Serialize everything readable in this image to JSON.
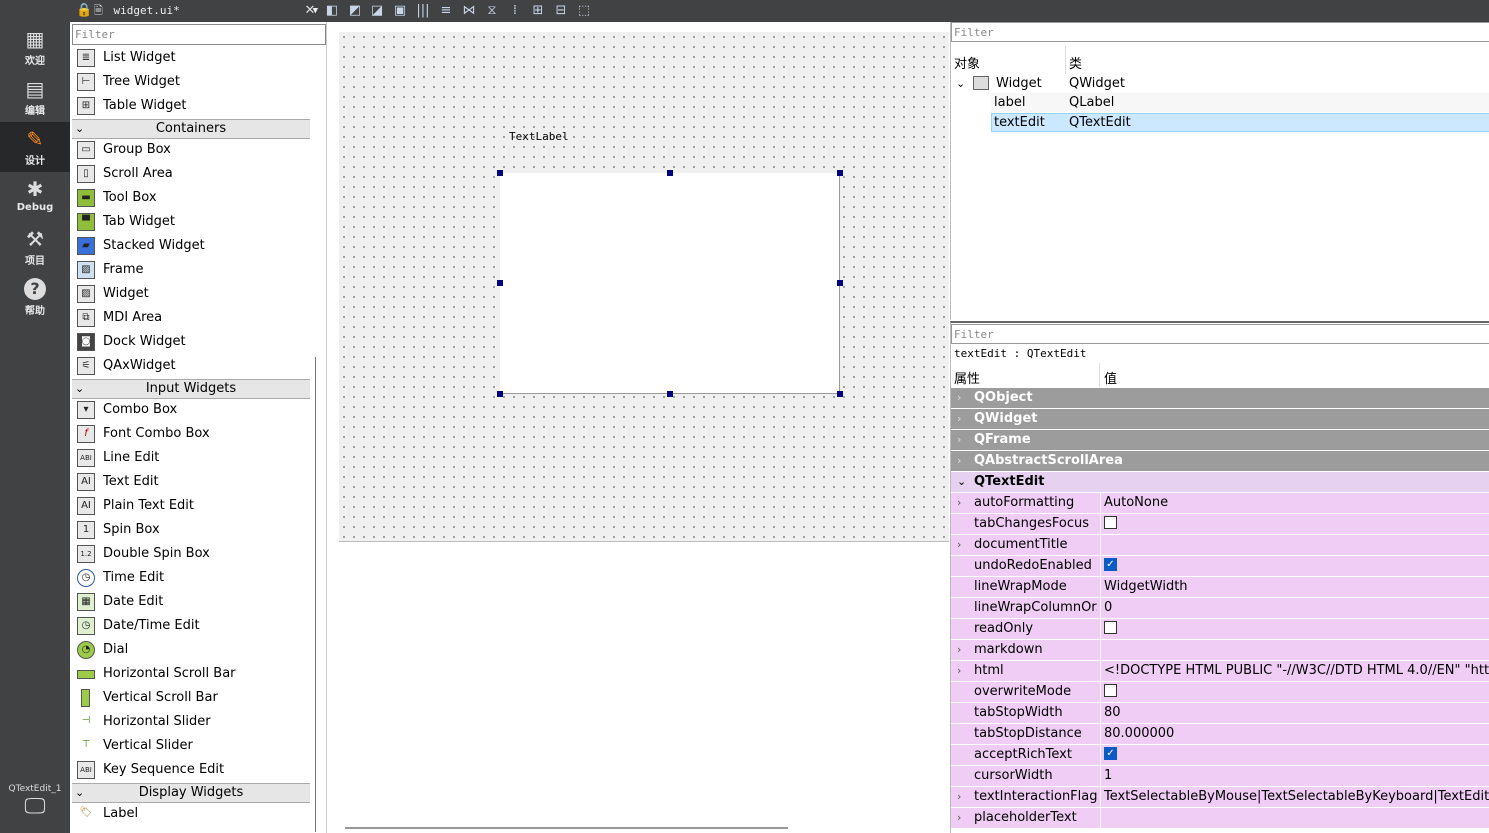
{
  "modes": [
    {
      "label": "欢迎",
      "icon": "grid-icon"
    },
    {
      "label": "编辑",
      "icon": "document-icon"
    },
    {
      "label": "设计",
      "icon": "pencil-icon"
    },
    {
      "label": "Debug",
      "icon": "bug-icon"
    },
    {
      "label": "项目",
      "icon": "wrench-icon"
    },
    {
      "label": "帮助",
      "icon": "help-icon"
    }
  ],
  "kit_label": "QTextEdit_1",
  "file_tab": "widget.ui*",
  "widget_box": {
    "filter_placeholder": "Filter",
    "items_top": [
      "List Widget",
      "Tree Widget",
      "Table Widget"
    ],
    "cat_containers": "Containers",
    "containers": [
      "Group Box",
      "Scroll Area",
      "Tool Box",
      "Tab Widget",
      "Stacked Widget",
      "Frame",
      "Widget",
      "MDI Area",
      "Dock Widget",
      "QAxWidget"
    ],
    "cat_input": "Input Widgets",
    "inputs": [
      "Combo Box",
      "Font Combo Box",
      "Line Edit",
      "Text Edit",
      "Plain Text Edit",
      "Spin Box",
      "Double Spin Box",
      "Time Edit",
      "Date Edit",
      "Date/Time Edit",
      "Dial",
      "Horizontal Scroll Bar",
      "Vertical Scroll Bar",
      "Horizontal Slider",
      "Vertical Slider",
      "Key Sequence Edit"
    ],
    "cat_display": "Display Widgets",
    "displays": [
      "Label"
    ]
  },
  "form": {
    "text_label": "TextLabel"
  },
  "object_inspector": {
    "filter_placeholder": "Filter",
    "col_object": "对象",
    "col_class": "类",
    "rows": [
      {
        "object": "Widget",
        "class": "QWidget"
      },
      {
        "object": "label",
        "class": "QLabel"
      },
      {
        "object": "textEdit",
        "class": "QTextEdit"
      }
    ]
  },
  "property_editor": {
    "filter_placeholder": "Filter",
    "context": "textEdit : QTextEdit",
    "col_property": "属性",
    "col_value": "值",
    "groups": [
      "QObject",
      "QWidget",
      "QFrame",
      "QAbstractScrollArea",
      "QTextEdit"
    ],
    "props": [
      {
        "name": "autoFormatting",
        "value": "AutoNone"
      },
      {
        "name": "tabChangesFocus",
        "value": ""
      },
      {
        "name": "documentTitle",
        "value": ""
      },
      {
        "name": "undoRedoEnabled",
        "value": ""
      },
      {
        "name": "lineWrapMode",
        "value": "WidgetWidth"
      },
      {
        "name": "lineWrapColumnOr...",
        "value": "0"
      },
      {
        "name": "readOnly",
        "value": ""
      },
      {
        "name": "markdown",
        "value": ""
      },
      {
        "name": "html",
        "value": "<!DOCTYPE HTML PUBLIC \"-//W3C//DTD HTML 4.0//EN\" \"http://w"
      },
      {
        "name": "overwriteMode",
        "value": ""
      },
      {
        "name": "tabStopWidth",
        "value": "80"
      },
      {
        "name": "tabStopDistance",
        "value": "80.000000"
      },
      {
        "name": "acceptRichText",
        "value": ""
      },
      {
        "name": "cursorWidth",
        "value": "1"
      },
      {
        "name": "textInteractionFlags",
        "value": "TextSelectableByMouse|TextSelectableByKeyboard|TextEditable|Te"
      },
      {
        "name": "placeholderText",
        "value": ""
      }
    ]
  },
  "colors": {
    "selection": "#cce8ff",
    "accent": "#ff8c1a",
    "property_row": "#f0cdf5"
  }
}
